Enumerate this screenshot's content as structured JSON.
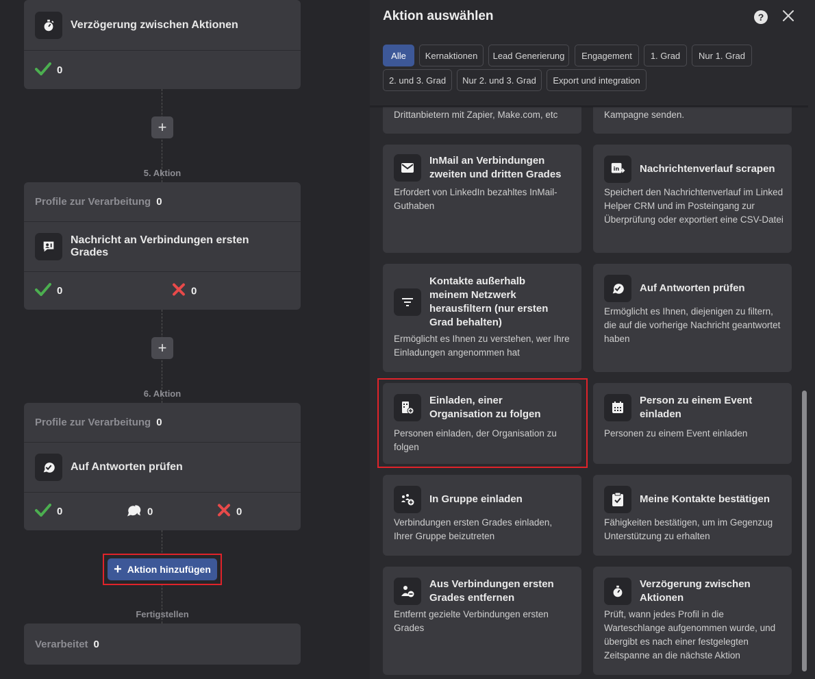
{
  "left": {
    "card1": {
      "title": "Verzögerung zwischen Aktionen",
      "success": "0"
    },
    "step5": {
      "label": "5. Aktion",
      "profiles_label": "Profile zur Verarbeitung",
      "profiles_value": "0",
      "title": "Nachricht an Verbindungen ersten Grades",
      "success": "0",
      "failed": "0"
    },
    "step6": {
      "label": "6. Aktion",
      "profiles_label": "Profile zur Verarbeitung",
      "profiles_value": "0",
      "title": "Auf Antworten prüfen",
      "success": "0",
      "replied": "0",
      "failed": "0"
    },
    "add_action_label": "Aktion hinzufügen",
    "finish": {
      "label": "Fertigstellen",
      "processed_label": "Verarbeitet",
      "processed_value": "0"
    }
  },
  "panel": {
    "title": "Aktion auswählen",
    "help_label": "?",
    "filters": [
      "Alle",
      "Kernaktionen",
      "Lead Generierung",
      "Engagement",
      "1. Grad",
      "Nur 1. Grad",
      "2. und 3. Grad",
      "Nur 2. und 3. Grad",
      "Export und integration"
    ],
    "active_filter": "Alle",
    "partial_tiles": [
      {
        "desc": "Drittanbietern mit Zapier, Make.com, etc"
      },
      {
        "desc": "Kampagne senden."
      }
    ],
    "tiles": [
      {
        "title": "InMail an Verbindungen zweiten und dritten Grades",
        "desc": "Erfordert von LinkedIn bezahltes InMail-Guthaben",
        "icon": "mail-icon"
      },
      {
        "title": "Nachrichtenverlauf scrapen",
        "desc": "Speichert den Nachrichtenverlauf im Linked Helper CRM und im Posteingang zur Überprüfung oder exportiert eine CSV-Datei",
        "icon": "linkedin-scrape-icon"
      },
      {
        "title": "Kontakte außerhalb meinem Netzwerk herausfiltern (nur ersten Grad behalten)",
        "desc": "Ermöglicht es Ihnen zu verstehen, wer Ihre Einladungen angenommen hat",
        "icon": "filter-icon"
      },
      {
        "title": "Auf Antworten prüfen",
        "desc": "Ermöglicht es Ihnen, diejenigen zu filtern, die auf die vorherige Nachricht geantwortet haben",
        "icon": "reply-check-icon"
      },
      {
        "title": "Einladen, einer Organisation zu folgen",
        "desc": "Personen einladen, der Organisation zu folgen",
        "icon": "organization-add-icon"
      },
      {
        "title": "Person zu einem Event einladen",
        "desc": "Personen zu einem Event einladen",
        "icon": "calendar-icon"
      },
      {
        "title": "In Gruppe einladen",
        "desc": "Verbindungen ersten Grades einladen, Ihrer Gruppe beizutreten",
        "icon": "group-add-icon"
      },
      {
        "title": "Meine Kontakte bestätigen",
        "desc": "Fähigkeiten bestätigen, um im Gegenzug Unterstützung zu erhalten",
        "icon": "clipboard-check-icon"
      },
      {
        "title": "Aus Verbindungen ersten Grades entfernen",
        "desc": "Entfernt gezielte Verbindungen ersten Grades",
        "icon": "person-remove-icon"
      },
      {
        "title": "Verzögerung zwischen Aktionen",
        "desc": "Prüft, wann jedes Profil in die Warteschlange aufgenommen wurde, und übergibt es nach einer festgelegten Zeitspanne an die nächste Aktion",
        "icon": "timer-icon"
      }
    ]
  },
  "colors": {
    "accent": "#3d5898",
    "success": "#4caf50",
    "error": "#e84a4a",
    "highlight": "#e0232a"
  }
}
